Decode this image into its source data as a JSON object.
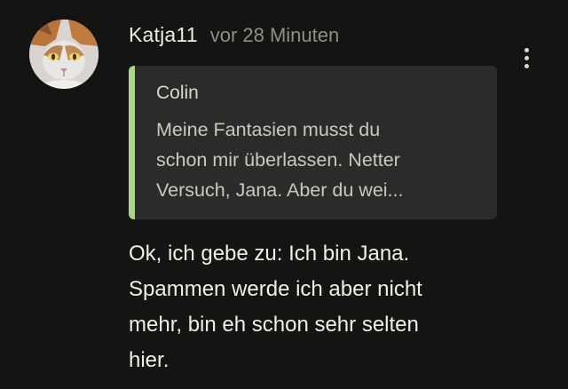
{
  "comment": {
    "avatar_icon": "cat-avatar-icon",
    "username": "Katja11",
    "timestamp": "vor 28 Minuten",
    "menu_icon": "more-vertical-icon",
    "quote": {
      "author": "Colin",
      "lines": [
        "Meine Fantasien musst du",
        "schon mir überlassen. Netter",
        "Versuch, Jana. Aber du wei..."
      ],
      "accent_color": "#a6d785"
    },
    "body_lines": [
      "Ok, ich gebe zu: Ich bin Jana.",
      "Spammen werde ich aber nicht",
      "mehr, bin eh schon sehr selten",
      "hier."
    ]
  }
}
